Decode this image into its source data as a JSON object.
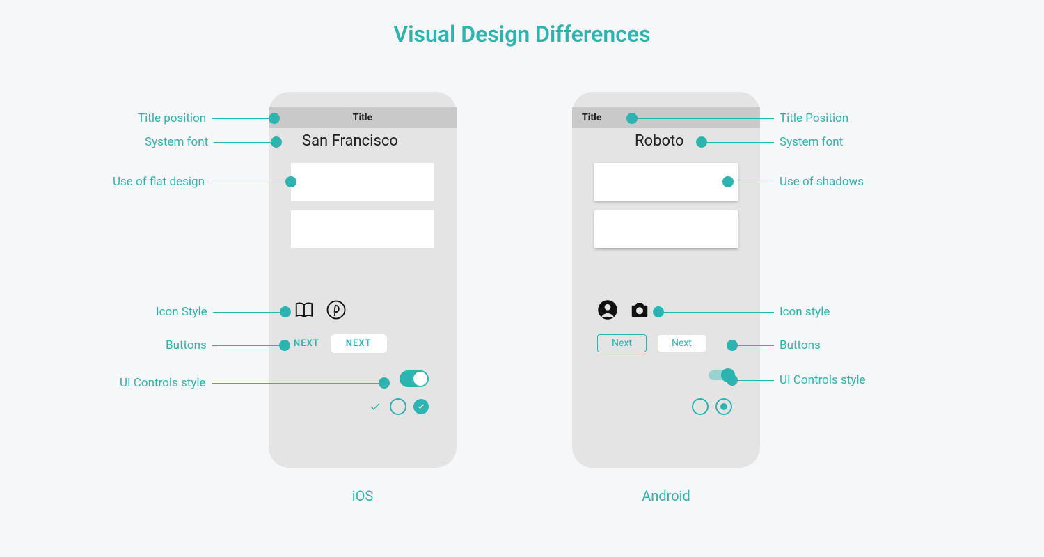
{
  "page_title": "Visual Design Differences",
  "ios": {
    "label": "iOS",
    "title_bar": "Title",
    "system_font": "San Francisco",
    "button_flat": "NEXT",
    "button_raised": "NEXT",
    "annotations": {
      "title_position": "Title position",
      "system_font": "System font",
      "flat_design": "Use of flat design",
      "icon_style": "Icon Style",
      "buttons": "Buttons",
      "ui_controls": "UI Controls style"
    }
  },
  "android": {
    "label": "Android",
    "title_bar": "Title",
    "system_font": "Roboto",
    "button_outline": "Next",
    "button_fill": "Next",
    "annotations": {
      "title_position": "Title Position",
      "system_font": "System font",
      "shadows": "Use of shadows",
      "icon_style": "Icon style",
      "buttons": "Buttons",
      "ui_controls": "UI Controls style"
    }
  }
}
